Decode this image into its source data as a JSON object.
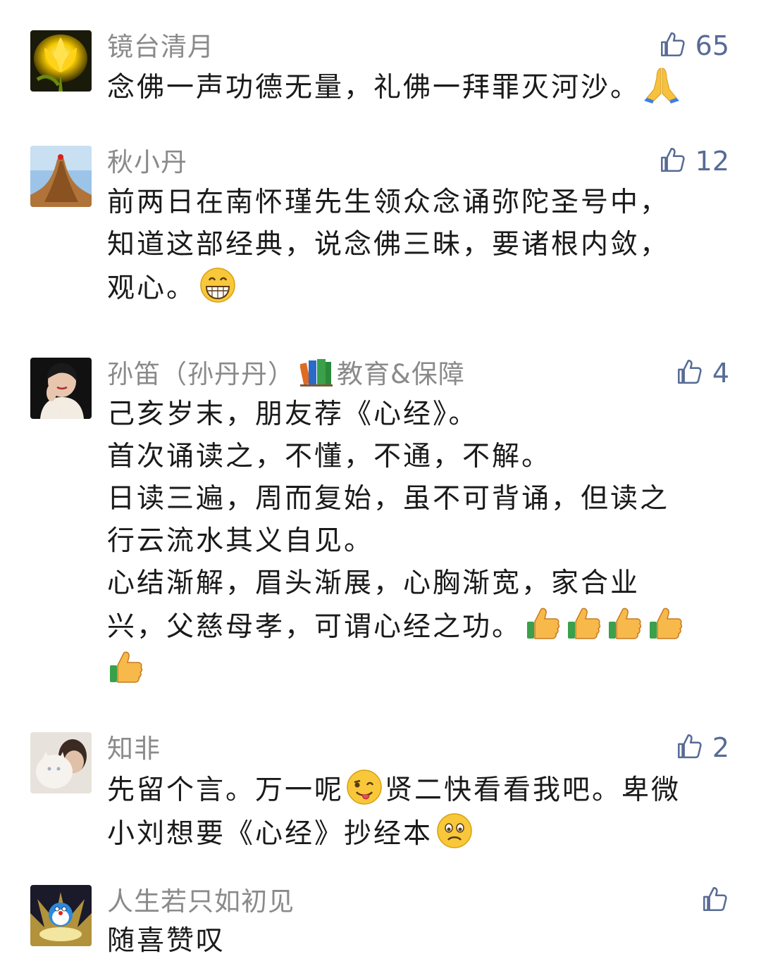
{
  "comments": [
    {
      "name": "镜台清月",
      "likes": "65",
      "lines": [
        "念佛一声功德无量，礼佛一拜罪灭河沙。"
      ],
      "trailing_emoji": [
        "pray-emoji"
      ]
    },
    {
      "name": "秋小丹",
      "likes": "12",
      "lines": [
        "前两日在南怀瑾先生领众念诵弥陀圣号中，",
        "知道这部经典，说念佛三昧，要诸根内敛，",
        "观心。"
      ],
      "trailing_emoji": [
        "grin-emoji"
      ]
    },
    {
      "name": "孙笛（孙丹丹）",
      "name_suffix": "教育&保障",
      "name_icon": "books-icon",
      "likes": "4",
      "lines": [
        "己亥岁末，朋友荐《心经》。",
        "首次诵读之，不懂，不通，不解。",
        "日读三遍，周而复始，虽不可背诵，但读之",
        "行云流水其义自见。",
        "心结渐解，眉头渐展，心胸渐宽，家合业",
        "兴，父慈母孝，可谓心经之功。"
      ],
      "trailing_emoji": [
        "thumbs-up-emoji",
        "thumbs-up-emoji",
        "thumbs-up-emoji",
        "thumbs-up-emoji",
        "thumbs-up-emoji"
      ]
    },
    {
      "name": "知非",
      "likes": "2",
      "lines": [
        "先留个言。万一呢",
        "贤二快看看我吧。卑微",
        "小刘想要《心经》抄经本"
      ],
      "inline_emoji": "wink-tongue-emoji",
      "trailing_emoji": [
        "frown-emoji"
      ]
    },
    {
      "name": "人生若只如初见",
      "likes": "",
      "lines": [
        "随喜赞叹"
      ]
    }
  ],
  "colors": {
    "name": "#8a8a8a",
    "like": "#576b95",
    "text": "#1a1a1a"
  }
}
